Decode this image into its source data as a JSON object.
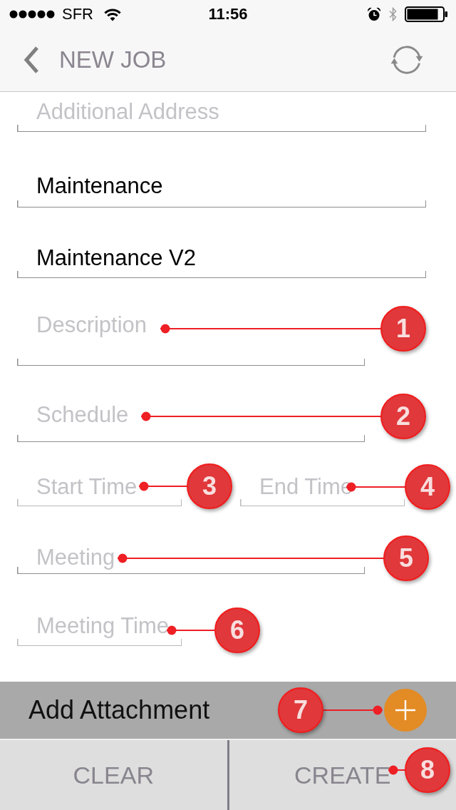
{
  "status_bar": {
    "carrier": "SFR",
    "time": "11:56"
  },
  "nav_bar": {
    "title": "NEW JOB"
  },
  "form": {
    "rows": [
      {
        "fields": [
          {
            "placeholder": "Additional Address"
          }
        ]
      },
      {
        "fields": [
          {
            "value": "Maintenance"
          }
        ]
      },
      {
        "fields": [
          {
            "value": "Maintenance V2"
          }
        ]
      },
      {
        "fields": [
          {
            "placeholder": "Description"
          }
        ]
      },
      {
        "fields": [
          {
            "placeholder": "Schedule"
          }
        ]
      },
      {
        "fields": [
          {
            "placeholder": "Start Time"
          },
          {
            "placeholder": "End Time"
          }
        ]
      },
      {
        "fields": [
          {
            "placeholder": "Meeting"
          }
        ]
      },
      {
        "fields": [
          {
            "placeholder": "Meeting Time"
          }
        ]
      }
    ]
  },
  "attachment_bar": {
    "label": "Add Attachment"
  },
  "buttons": [
    {
      "label": "CLEAR"
    },
    {
      "label": "CREATE"
    }
  ],
  "callouts": [
    {
      "number": "1"
    },
    {
      "number": "2"
    },
    {
      "number": "3"
    },
    {
      "number": "4"
    },
    {
      "number": "5"
    },
    {
      "number": "6"
    },
    {
      "number": "7"
    },
    {
      "number": "8"
    }
  ]
}
